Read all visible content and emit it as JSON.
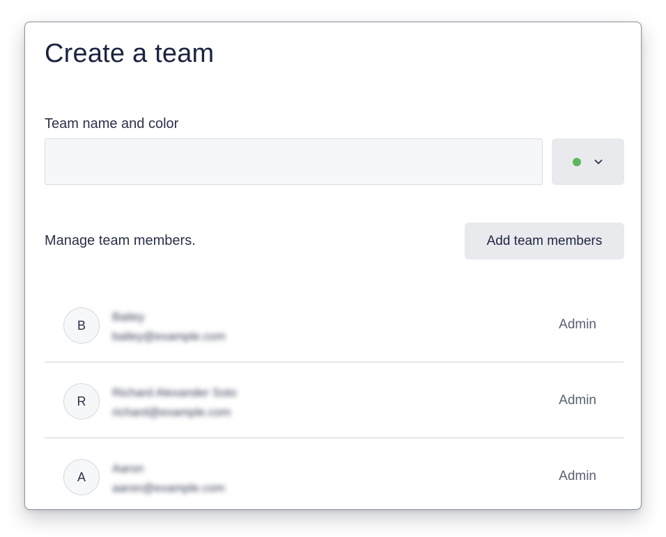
{
  "dialog": {
    "title": "Create a team"
  },
  "team_field": {
    "label": "Team name and color",
    "value": "",
    "placeholder": "",
    "selected_color": "#5cb85c"
  },
  "members_section": {
    "label": "Manage team members.",
    "add_button_label": "Add team members"
  },
  "members": [
    {
      "initial": "B",
      "name": "Bailey",
      "email": "bailey@example.com",
      "role": "Admin"
    },
    {
      "initial": "R",
      "name": "Richard Alexander Soto",
      "email": "richard@example.com",
      "role": "Admin"
    },
    {
      "initial": "A",
      "name": "Aaron",
      "email": "aaron@example.com",
      "role": "Admin"
    }
  ],
  "icons": {
    "color_swatch": "color-dot-icon",
    "dropdown": "chevron-down-icon"
  }
}
